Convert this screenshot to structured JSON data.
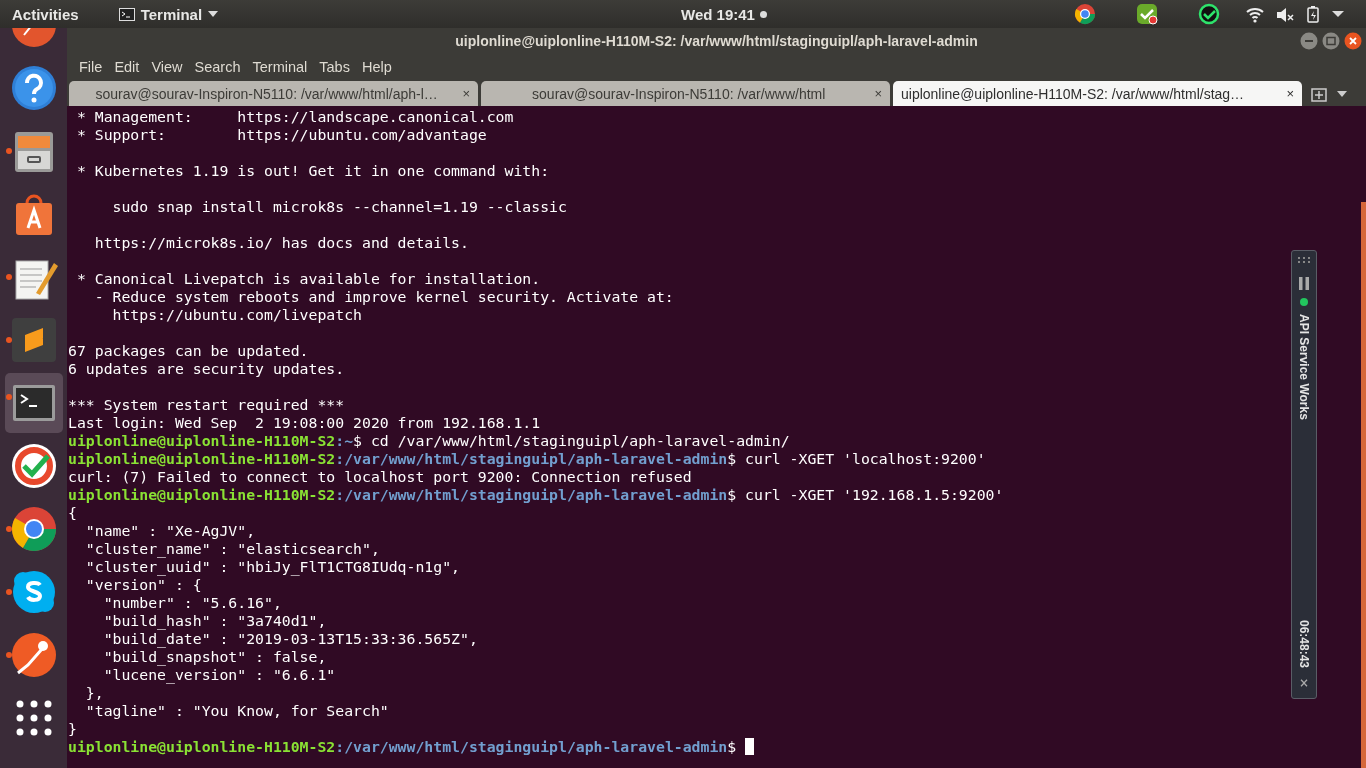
{
  "top_bar": {
    "activities": "Activities",
    "app_menu": "Terminal",
    "clock": "Wed 19:41",
    "notification_dot": true
  },
  "dock": {
    "items": [
      {
        "selected": false
      },
      {
        "running": false,
        "selected": false
      },
      {
        "running": true,
        "selected": false
      },
      {
        "running": false,
        "selected": false
      },
      {
        "running": true,
        "selected": false
      },
      {
        "running": true,
        "selected": false
      },
      {
        "running": true,
        "selected": true
      },
      {
        "running": false,
        "selected": false
      },
      {
        "running": true,
        "selected": false
      },
      {
        "running": true,
        "selected": false
      },
      {
        "running": true,
        "selected": false
      },
      {
        "running": false,
        "selected": false
      }
    ]
  },
  "window": {
    "title": "uiplonline@uiplonline-H110M-S2: /var/www/html/staginguipl/aph-laravel-admin",
    "menu": [
      "File",
      "Edit",
      "View",
      "Search",
      "Terminal",
      "Tabs",
      "Help"
    ],
    "tabs": [
      {
        "label": "sourav@sourav-Inspiron-N5110: /var/www/html/aph-l…",
        "selected": false
      },
      {
        "label": "sourav@sourav-Inspiron-N5110: /var/www/html",
        "selected": false
      },
      {
        "label": "uiplonline@uiplonline-H110M-S2: /var/www/html/stag…",
        "selected": true
      }
    ],
    "close_glyph": "×"
  },
  "terminal": {
    "lines": [
      {
        "kind": "text",
        "text": " * Management:     https://landscape.canonical.com"
      },
      {
        "kind": "text",
        "text": " * Support:        https://ubuntu.com/advantage"
      },
      {
        "kind": "blank"
      },
      {
        "kind": "text",
        "text": " * Kubernetes 1.19 is out! Get it in one command with:"
      },
      {
        "kind": "blank"
      },
      {
        "kind": "text",
        "text": "     sudo snap install microk8s --channel=1.19 --classic"
      },
      {
        "kind": "blank"
      },
      {
        "kind": "text",
        "text": "   https://microk8s.io/ has docs and details."
      },
      {
        "kind": "blank"
      },
      {
        "kind": "text",
        "text": " * Canonical Livepatch is available for installation."
      },
      {
        "kind": "text",
        "text": "   - Reduce system reboots and improve kernel security. Activate at:"
      },
      {
        "kind": "text",
        "text": "     https://ubuntu.com/livepatch"
      },
      {
        "kind": "blank"
      },
      {
        "kind": "text",
        "text": "67 packages can be updated."
      },
      {
        "kind": "text",
        "text": "6 updates are security updates."
      },
      {
        "kind": "blank"
      },
      {
        "kind": "text",
        "text": "*** System restart required ***"
      },
      {
        "kind": "text",
        "text": "Last login: Wed Sep  2 19:08:00 2020 from 192.168.1.1"
      },
      {
        "kind": "prompt",
        "user": "uiplonline@uiplonline-H110M-S2",
        "path": ":~",
        "command": "$ cd /var/www/html/staginguipl/aph-laravel-admin/"
      },
      {
        "kind": "prompt",
        "user": "uiplonline@uiplonline-H110M-S2",
        "path": ":/var/www/html/staginguipl/aph-laravel-admin",
        "command": "$ curl -XGET 'localhost:9200'"
      },
      {
        "kind": "text",
        "text": "curl: (7) Failed to connect to localhost port 9200: Connection refused"
      },
      {
        "kind": "prompt",
        "user": "uiplonline@uiplonline-H110M-S2",
        "path": ":/var/www/html/staginguipl/aph-laravel-admin",
        "command": "$ curl -XGET '192.168.1.5:9200'"
      },
      {
        "kind": "text",
        "text": "{"
      },
      {
        "kind": "text",
        "text": "  \"name\" : \"Xe-AgJV\","
      },
      {
        "kind": "text",
        "text": "  \"cluster_name\" : \"elasticsearch\","
      },
      {
        "kind": "text",
        "text": "  \"cluster_uuid\" : \"hbiJy_FlT1CTG8IUdq-n1g\","
      },
      {
        "kind": "text",
        "text": "  \"version\" : {"
      },
      {
        "kind": "text",
        "text": "    \"number\" : \"5.6.16\","
      },
      {
        "kind": "text",
        "text": "    \"build_hash\" : \"3a740d1\","
      },
      {
        "kind": "text",
        "text": "    \"build_date\" : \"2019-03-13T15:33:36.565Z\","
      },
      {
        "kind": "text",
        "text": "    \"build_snapshot\" : false,"
      },
      {
        "kind": "text",
        "text": "    \"lucene_version\" : \"6.6.1\""
      },
      {
        "kind": "text",
        "text": "  },"
      },
      {
        "kind": "text",
        "text": "  \"tagline\" : \"You Know, for Search\""
      },
      {
        "kind": "text",
        "text": "}"
      },
      {
        "kind": "prompt",
        "user": "uiplonline@uiplonline-H110M-S2",
        "path": ":/var/www/html/staginguipl/aph-laravel-admin",
        "command": "$ ",
        "cursor": true
      }
    ]
  },
  "widget": {
    "active": true,
    "label": "API Service Works",
    "timer": "06:48:43",
    "close": "×"
  }
}
